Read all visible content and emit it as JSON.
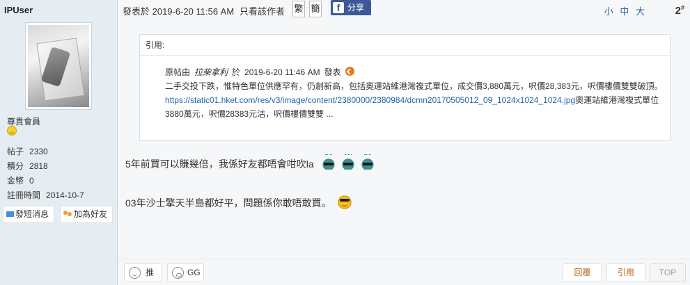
{
  "author": {
    "name": "IPUser",
    "rank": "尊貴會員",
    "stats": [
      {
        "label": "帖子",
        "value": "2330"
      },
      {
        "label": "積分",
        "value": "2818"
      },
      {
        "label": "金幣",
        "value": "0"
      },
      {
        "label": "註冊時間",
        "value": "2014-10-7"
      }
    ],
    "send_message": "發短消息",
    "add_friend": "加為好友"
  },
  "post_header": {
    "posted_at": "發表於 2019-6-20 11:56 AM",
    "author_only": "只看該作者",
    "traditional": "繁",
    "simplified": "簡",
    "share": "分享",
    "font_sizes": "小 中 大",
    "floor_number": "2",
    "floor_mark": "#"
  },
  "quote": {
    "title": "引用:",
    "by_prefix": "原帖由",
    "by_user": "拉柴拿利",
    "by_at": "於",
    "by_time": "2019-6-20  11:46  AM",
    "by_suffix": "發表",
    "text": "二手交投下跌，惟特色單位供應罕有，仍創新高，包括奧運站維港灣複式單位，成交價3,880萬元，呎價28,383元，呎價樓價雙雙破頂。",
    "link": "https://static01.hket.com/res/v3/image/content/2380000/2380984/dcmn20170505012_09_1024x1024_1024.jpg",
    "link_tail": "奧運站維港灣複式單位3880萬元，呎價28383元沽，呎價樓價雙雙   ..."
  },
  "messages": [
    "5年前買可以賺幾倍，我係好友都唔會咁吹la",
    "03年沙士擎天半島都好平，問題係你敢唔敢買。"
  ],
  "footer": {
    "push": "推",
    "gg": "GG",
    "reply": "回覆",
    "quote": "引用",
    "top": "TOP"
  },
  "icons": {
    "facebook": "facebook-icon",
    "back_arrow": "back-arrow-icon",
    "emoji": "emoji-icon"
  }
}
